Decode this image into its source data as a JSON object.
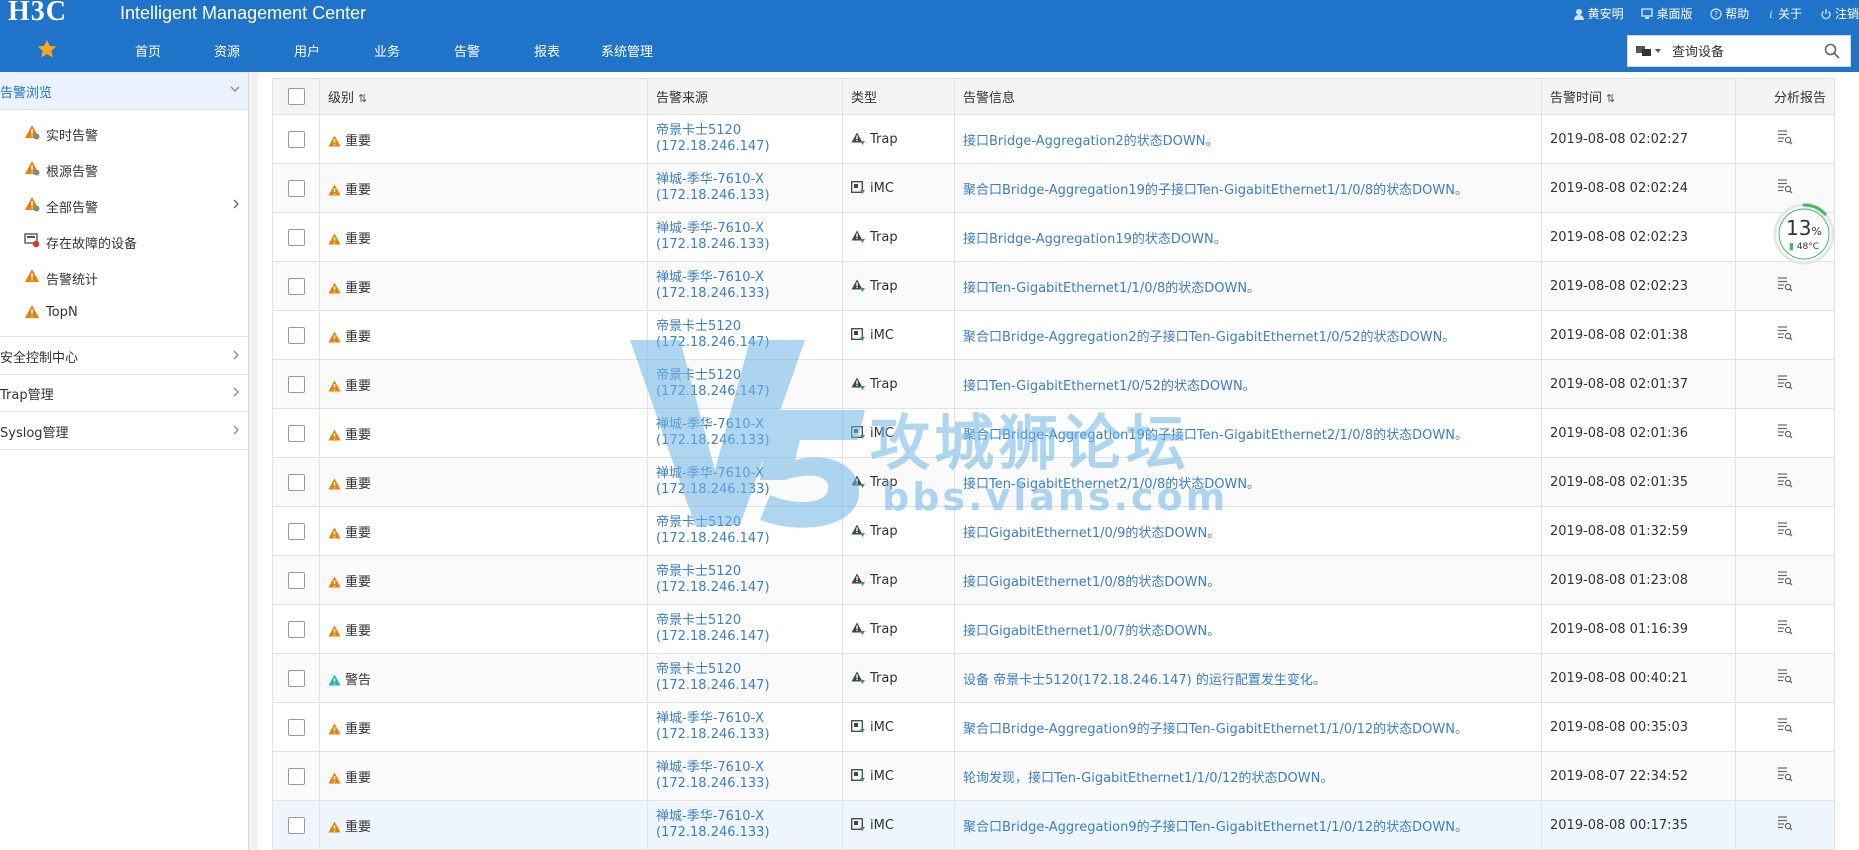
{
  "header": {
    "logo": "H3C",
    "app_title": "Intelligent Management Center",
    "user": "黄安明",
    "desktop_label": "桌面版",
    "help_label": "帮助",
    "about_label": "关于",
    "logout_label": "注销"
  },
  "nav": {
    "items": [
      "首页",
      "资源",
      "用户",
      "业务",
      "告警",
      "报表",
      "系统管理"
    ]
  },
  "search": {
    "placeholder": "查询设备"
  },
  "sidebar": {
    "section_title": "告警浏览",
    "items": [
      "实时告警",
      "根源告警",
      "全部告警",
      "存在故障的设备",
      "告警统计",
      "TopN"
    ],
    "sections": [
      "安全控制中心",
      "Trap管理",
      "Syslog管理"
    ]
  },
  "table": {
    "columns": {
      "level": "级别",
      "source": "告警来源",
      "type": "类型",
      "info": "告警信息",
      "time": "告警时间",
      "report": "分析报告"
    },
    "rows": [
      {
        "level": "重要",
        "src_name": "帝景卡士5120",
        "src_ip": "(172.18.246.147)",
        "type": "Trap",
        "info": "接口Bridge-Aggregation2的状态DOWN。",
        "time": "2019-08-08 02:02:27"
      },
      {
        "level": "重要",
        "src_name": "禅城-季华-7610-X",
        "src_ip": "(172.18.246.133)",
        "type": "iMC",
        "info": "聚合口Bridge-Aggregation19的子接口Ten-GigabitEthernet1/1/0/8的状态DOWN。",
        "time": "2019-08-08 02:02:24"
      },
      {
        "level": "重要",
        "src_name": "禅城-季华-7610-X",
        "src_ip": "(172.18.246.133)",
        "type": "Trap",
        "info": "接口Bridge-Aggregation19的状态DOWN。",
        "time": "2019-08-08 02:02:23"
      },
      {
        "level": "重要",
        "src_name": "禅城-季华-7610-X",
        "src_ip": "(172.18.246.133)",
        "type": "Trap",
        "info": "接口Ten-GigabitEthernet1/1/0/8的状态DOWN。",
        "time": "2019-08-08 02:02:23"
      },
      {
        "level": "重要",
        "src_name": "帝景卡士5120",
        "src_ip": "(172.18.246.147)",
        "type": "iMC",
        "info": "聚合口Bridge-Aggregation2的子接口Ten-GigabitEthernet1/0/52的状态DOWN。",
        "time": "2019-08-08 02:01:38"
      },
      {
        "level": "重要",
        "src_name": "帝景卡士5120",
        "src_ip": "(172.18.246.147)",
        "type": "Trap",
        "info": "接口Ten-GigabitEthernet1/0/52的状态DOWN。",
        "time": "2019-08-08 02:01:37"
      },
      {
        "level": "重要",
        "src_name": "禅城-季华-7610-X",
        "src_ip": "(172.18.246.133)",
        "type": "iMC",
        "info": "聚合口Bridge-Aggregation19的子接口Ten-GigabitEthernet2/1/0/8的状态DOWN。",
        "time": "2019-08-08 02:01:36"
      },
      {
        "level": "重要",
        "src_name": "禅城-季华-7610-X",
        "src_ip": "(172.18.246.133)",
        "type": "Trap",
        "info": "接口Ten-GigabitEthernet2/1/0/8的状态DOWN。",
        "time": "2019-08-08 02:01:35"
      },
      {
        "level": "重要",
        "src_name": "帝景卡士5120",
        "src_ip": "(172.18.246.147)",
        "type": "Trap",
        "info": "接口GigabitEthernet1/0/9的状态DOWN。",
        "time": "2019-08-08 01:32:59"
      },
      {
        "level": "重要",
        "src_name": "帝景卡士5120",
        "src_ip": "(172.18.246.147)",
        "type": "Trap",
        "info": "接口GigabitEthernet1/0/8的状态DOWN。",
        "time": "2019-08-08 01:23:08"
      },
      {
        "level": "重要",
        "src_name": "帝景卡士5120",
        "src_ip": "(172.18.246.147)",
        "type": "Trap",
        "info": "接口GigabitEthernet1/0/7的状态DOWN。",
        "time": "2019-08-08 01:16:39"
      },
      {
        "level": "警告",
        "src_name": "帝景卡士5120",
        "src_ip": "(172.18.246.147)",
        "type": "Trap",
        "info": "设备 帝景卡士5120(172.18.246.147) 的运行配置发生变化。",
        "time": "2019-08-08 00:40:21"
      },
      {
        "level": "重要",
        "src_name": "禅城-季华-7610-X",
        "src_ip": "(172.18.246.133)",
        "type": "iMC",
        "info": "聚合口Bridge-Aggregation9的子接口Ten-GigabitEthernet1/1/0/12的状态DOWN。",
        "time": "2019-08-08 00:35:03"
      },
      {
        "level": "重要",
        "src_name": "禅城-季华-7610-X",
        "src_ip": "(172.18.246.133)",
        "type": "iMC",
        "info": "轮询发现，接口Ten-GigabitEthernet1/1/0/12的状态DOWN。",
        "time": "2019-08-07 22:34:52"
      },
      {
        "level": "重要",
        "src_name": "禅城-季华-7610-X",
        "src_ip": "(172.18.246.133)",
        "type": "iMC",
        "info": "聚合口Bridge-Aggregation9的子接口Ten-GigabitEthernet1/1/0/12的状态DOWN。",
        "time": "2019-08-08 00:17:35"
      }
    ]
  },
  "watermark": {
    "brand": "攻城狮论坛",
    "url": "bbs.vlans.com"
  },
  "cpu_widget": {
    "percent": "13",
    "percent_unit": "%",
    "temperature": "48°C",
    "usage_fraction": 0.13
  },
  "colors": {
    "header_bg": "#1f73c8",
    "link": "#3a7fc8",
    "severity_major": "#f07d00",
    "severity_warning": "#19b8c8",
    "cpu_ring": "#3dbb5c"
  }
}
